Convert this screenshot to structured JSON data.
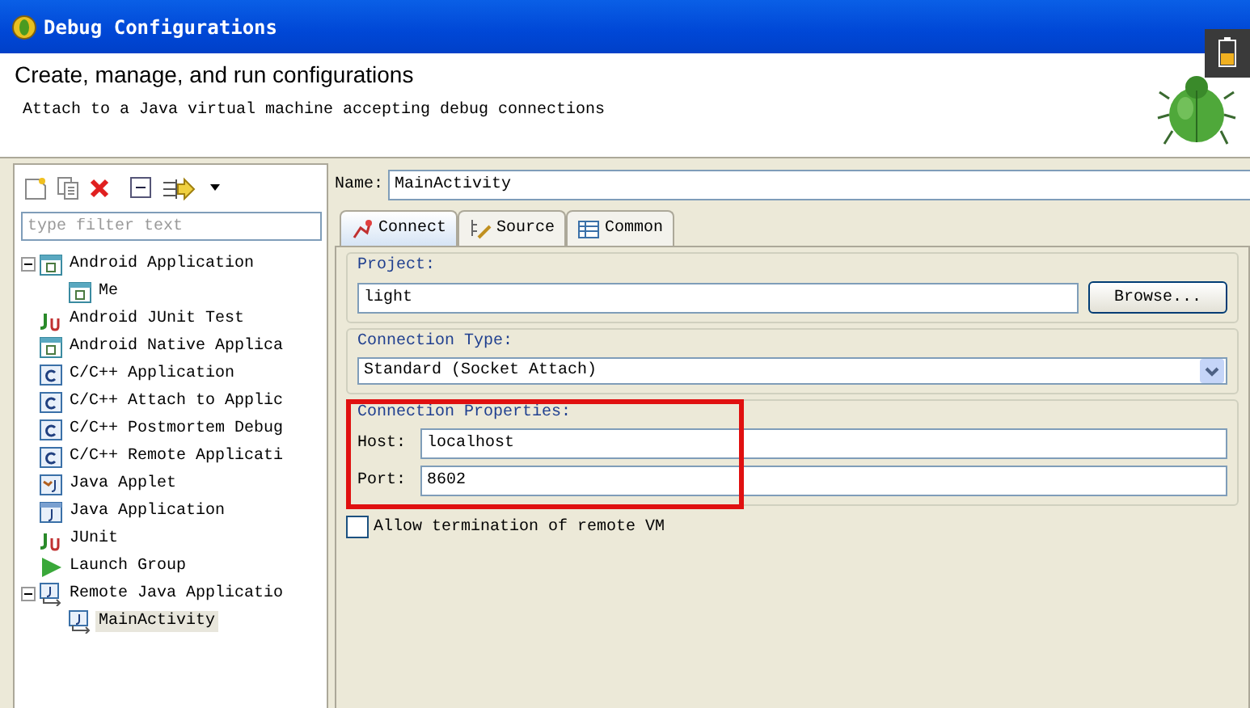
{
  "window": {
    "title": "Debug Configurations"
  },
  "header": {
    "title": "Create, manage, and run configurations",
    "message": "Attach to a Java virtual machine accepting debug connections"
  },
  "sidebar": {
    "filter": {
      "placeholder": "type filter text"
    },
    "items": [
      {
        "label": "Android Application",
        "kind": "android",
        "expanded": true,
        "selected": false,
        "children": [
          {
            "label": "Me",
            "kind": "android",
            "selected": false
          }
        ]
      },
      {
        "label": "Android JUnit Test",
        "kind": "junit",
        "selected": false
      },
      {
        "label": "Android Native Applica",
        "kind": "android",
        "selected": false
      },
      {
        "label": "C/C++ Application",
        "kind": "cpp",
        "selected": false
      },
      {
        "label": "C/C++ Attach to Applic",
        "kind": "cpp",
        "selected": false
      },
      {
        "label": "C/C++ Postmortem Debug",
        "kind": "cpp",
        "selected": false
      },
      {
        "label": "C/C++ Remote Applicati",
        "kind": "cpp",
        "selected": false
      },
      {
        "label": "Java Applet",
        "kind": "applet",
        "selected": false
      },
      {
        "label": "Java Application",
        "kind": "java",
        "selected": false
      },
      {
        "label": "JUnit",
        "kind": "junit",
        "selected": false
      },
      {
        "label": "Launch Group",
        "kind": "launch",
        "selected": false
      },
      {
        "label": "Remote Java Applicatio",
        "kind": "remote",
        "expanded": true,
        "selected": false,
        "children": [
          {
            "label": "MainActivity",
            "kind": "remote",
            "selected": true
          }
        ]
      }
    ]
  },
  "name": {
    "label": "Name:",
    "value": "MainActivity"
  },
  "tabs": [
    {
      "label": "Connect",
      "kind": "connect",
      "selected": true
    },
    {
      "label": "Source",
      "kind": "source",
      "selected": false
    },
    {
      "label": "Common",
      "kind": "common",
      "selected": false
    }
  ],
  "project": {
    "label": "Project:",
    "value": "light",
    "button": "Browse..."
  },
  "connection_type": {
    "label": "Connection Type:",
    "value": "Standard (Socket Attach)"
  },
  "connection_properties": {
    "label": "Connection Properties:",
    "fields": [
      {
        "label": "Host:",
        "value": "localhost"
      },
      {
        "label": "Port:",
        "value": "8602"
      }
    ]
  },
  "allow_termination": {
    "label": "Allow termination of remote VM",
    "checked": false
  }
}
